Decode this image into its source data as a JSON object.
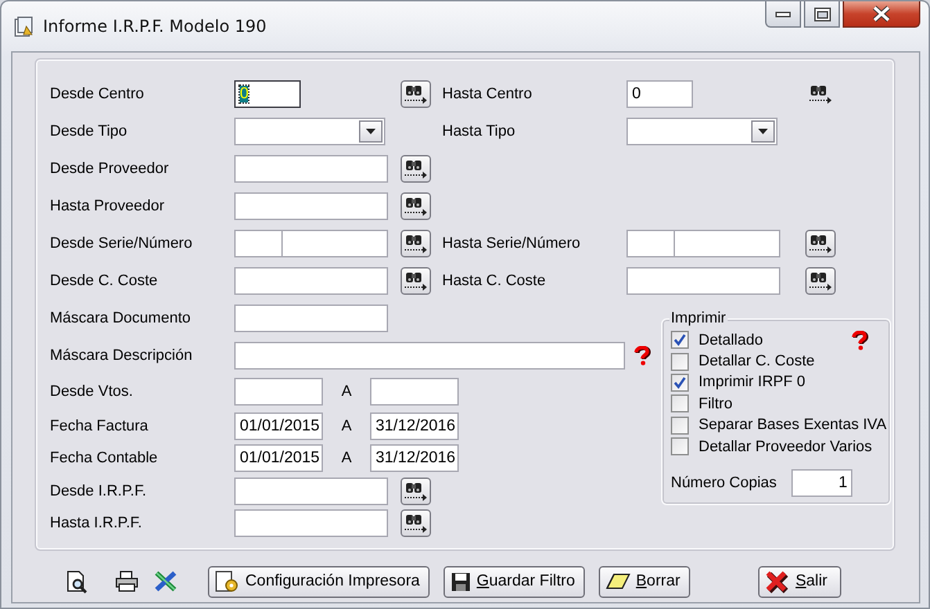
{
  "window": {
    "title": "Informe I.R.P.F. Modelo 190"
  },
  "top_rows": [
    {
      "label": "Desde Centro",
      "field": {
        "kind": "short",
        "value": "0",
        "focused": true
      },
      "action": {
        "kind": "lookup"
      },
      "right": {
        "label": "Hasta Centro",
        "field": {
          "kind": "short",
          "value": "0",
          "focused": false
        },
        "action": {
          "kind": "lookup-flat"
        }
      }
    },
    {
      "label": "Desde Tipo",
      "field": {
        "kind": "combo",
        "focused": false
      },
      "right": {
        "label": "Hasta Tipo",
        "field": {
          "kind": "combo",
          "focused": false
        }
      }
    },
    {
      "label": "Desde Proveedor",
      "field": {
        "kind": "text",
        "focused": false
      },
      "action": {
        "kind": "lookup"
      }
    },
    {
      "label": "Hasta Proveedor",
      "field": {
        "kind": "text",
        "focused": false
      },
      "action": {
        "kind": "lookup"
      }
    },
    {
      "label": "Desde Serie/Número",
      "field": {
        "kind": "split",
        "focused": false
      },
      "action": {
        "kind": "lookup"
      },
      "right": {
        "label": "Hasta Serie/Número",
        "field": {
          "kind": "split",
          "focused": false
        },
        "action": {
          "kind": "lookup"
        }
      }
    },
    {
      "label": "Desde C. Coste",
      "field": {
        "kind": "text",
        "focused": false
      },
      "action": {
        "kind": "lookup"
      },
      "right": {
        "label": "Hasta C. Coste",
        "field": {
          "kind": "text",
          "focused": false
        },
        "action": {
          "kind": "lookup"
        }
      }
    }
  ],
  "lower_rows": [
    {
      "label": "Máscara Documento",
      "field": {
        "kind": "text",
        "focused": false
      }
    },
    {
      "label": "Máscara Descripción",
      "field": {
        "kind": "wide",
        "focused": false
      },
      "action": {
        "kind": "help"
      }
    },
    {
      "label": "Desde Vtos.",
      "field": {
        "kind": "date",
        "focused": false
      },
      "range": {
        "label": "A",
        "field": {
          "kind": "date",
          "focused": false
        }
      }
    },
    {
      "label": "Fecha Factura",
      "field": {
        "kind": "date",
        "value": "01/01/2015",
        "focused": false
      },
      "range": {
        "label": "A",
        "field": {
          "kind": "date",
          "value": "31/12/2016",
          "focused": false
        }
      }
    },
    {
      "label": "Fecha Contable",
      "field": {
        "kind": "date",
        "value": "01/01/2015",
        "focused": false
      },
      "range": {
        "label": "A",
        "field": {
          "kind": "date",
          "value": "31/12/2016",
          "focused": false
        }
      }
    },
    {
      "label": "Desde I.R.P.F.",
      "field": {
        "kind": "text",
        "focused": false
      },
      "action": {
        "kind": "lookup"
      }
    },
    {
      "label": "Hasta I.R.P.F.",
      "field": {
        "kind": "text",
        "focused": false
      },
      "action": {
        "kind": "lookup"
      }
    }
  ],
  "print_options": {
    "title": "Imprimir",
    "options": [
      {
        "label": "Detallado",
        "checked": true,
        "help": true
      },
      {
        "label": "Detallar C. Coste",
        "checked": false,
        "help": false
      },
      {
        "label": "Imprimir IRPF 0",
        "checked": true,
        "help": false
      },
      {
        "label": "Filtro",
        "checked": false,
        "help": false
      },
      {
        "label": "Separar Bases Exentas IVA",
        "checked": false,
        "help": false
      },
      {
        "label": "Detallar Proveedor Varios",
        "checked": false,
        "help": false
      }
    ],
    "copies": {
      "label": "Número Copias",
      "value": "1"
    }
  },
  "buttons": [
    {
      "label": "Configuración Impresora",
      "kind": "setup",
      "mnemonic": false
    },
    {
      "label": "Guardar Filtro",
      "kind": "save",
      "mnemonic": true
    },
    {
      "label": "Borrar",
      "kind": "erase",
      "mnemonic": true
    },
    {
      "label": "Salir",
      "kind": "exit",
      "mnemonic": true
    }
  ]
}
